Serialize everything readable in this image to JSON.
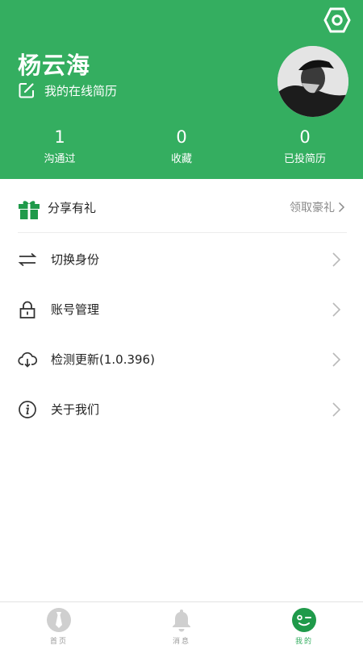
{
  "profile": {
    "name": "杨云海",
    "resume_label": "我的在线简历"
  },
  "stats": [
    {
      "value": "1",
      "label": "沟通过"
    },
    {
      "value": "0",
      "label": "收藏"
    },
    {
      "value": "0",
      "label": "已投简历"
    }
  ],
  "share": {
    "title": "分享有礼",
    "action": "领取豪礼"
  },
  "menu": [
    {
      "label": "切换身份",
      "icon": "swap-icon"
    },
    {
      "label": "账号管理",
      "icon": "lock-icon"
    },
    {
      "label": "检测更新(1.0.396)",
      "icon": "cloud-download-icon"
    },
    {
      "label": "关于我们",
      "icon": "info-icon"
    }
  ],
  "tabbar": [
    {
      "label": "首页",
      "icon": "tie-icon",
      "active": false
    },
    {
      "label": "消息",
      "icon": "bell-icon",
      "active": false
    },
    {
      "label": "我的",
      "icon": "smiley-icon",
      "active": true
    }
  ],
  "colors": {
    "brand_green": "#34ae60",
    "muted_text": "#8a8a8a",
    "divider": "#ececec"
  }
}
